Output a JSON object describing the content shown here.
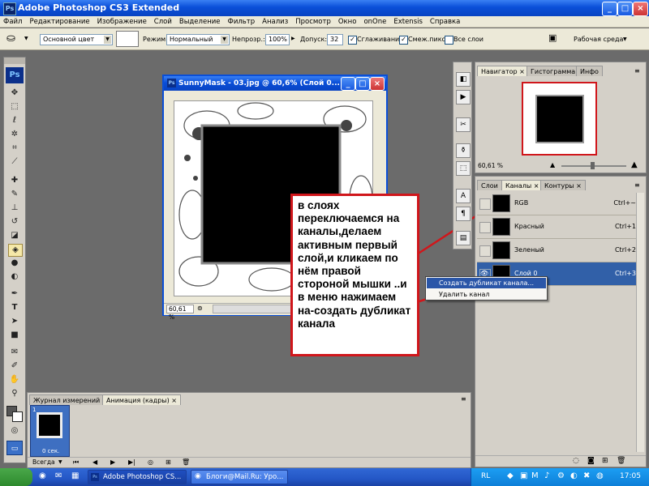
{
  "app": {
    "title": "Adobe Photoshop CS3 Extended"
  },
  "menu": [
    "Файл",
    "Редактирование",
    "Изображение",
    "Слой",
    "Выделение",
    "Фильтр",
    "Анализ",
    "Просмотр",
    "Окно",
    "onOne",
    "Extensis",
    "Справка"
  ],
  "options": {
    "source": "Основной цвет",
    "mode_label": "Режим:",
    "mode_value": "Нормальный",
    "opacity_label": "Непрозр.:",
    "opacity_value": "100%",
    "tolerance_label": "Допуск:",
    "tolerance_value": "32",
    "antialias_label": "Сглаживание",
    "contiguous_label": "Смеж.пикс",
    "all_layers_label": "Все слои",
    "workspace_label": "Рабочая среда"
  },
  "toolbox": {
    "logo": "Ps"
  },
  "document": {
    "title": "SunnyMask - 03.jpg @ 60,6% (Слой 0...",
    "zoom": "60,61 %"
  },
  "navigator": {
    "tabs": [
      "Навигатор",
      "Гистограмма",
      "Инфо"
    ],
    "zoom": "60,61 %"
  },
  "channels_panel": {
    "tabs": [
      "Слои",
      "Каналы",
      "Контуры"
    ],
    "rows": [
      {
        "name": "RGB",
        "shortcut": "Ctrl+~"
      },
      {
        "name": "Красный",
        "shortcut": "Ctrl+1"
      },
      {
        "name": "Зеленый",
        "shortcut": "Ctrl+2"
      },
      {
        "name": "Слой 0",
        "shortcut": "Ctrl+3"
      }
    ]
  },
  "context_menu": {
    "items": [
      "Создать дубликат канала...",
      "Удалить канал"
    ]
  },
  "annotation": {
    "text": "в слоях переключаемся на каналы,делаем активным первый слой,и кликаем по нём правой стороной мышки ..и в меню нажимаем на-создать дубликат канала"
  },
  "animation_panel": {
    "tabs": [
      "Журнал измерений",
      "Анимация (кадры)"
    ],
    "frame_number": "1",
    "frame_delay": "0 сек.",
    "loop": "Всегда"
  },
  "taskbar": {
    "items": [
      "Adobe Photoshop CS...",
      "Блоги@Mail.Ru: Уро..."
    ],
    "lang": "RL",
    "clock": "17:05"
  },
  "colors": {
    "xp_blue": "#0a4fd8",
    "annotation_border": "#d0161b",
    "selected_row": "#3160a8"
  }
}
